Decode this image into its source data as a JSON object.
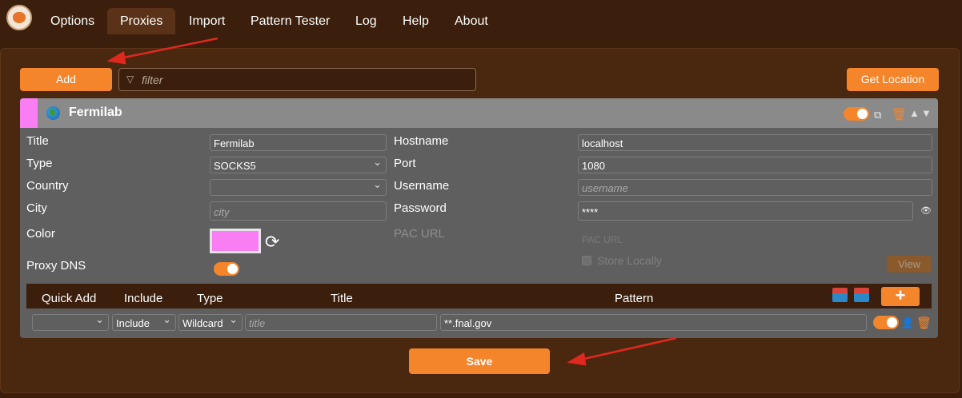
{
  "nav": {
    "tabs": [
      {
        "label": "Options"
      },
      {
        "label": "Proxies"
      },
      {
        "label": "Import"
      },
      {
        "label": "Pattern Tester"
      },
      {
        "label": "Log"
      },
      {
        "label": "Help"
      },
      {
        "label": "About"
      }
    ],
    "active_tab": "Proxies"
  },
  "toolbar": {
    "add_label": "Add",
    "filter_placeholder": "filter",
    "get_location_label": "Get Location"
  },
  "proxy": {
    "title": "Fermilab",
    "color": "#f97ef4",
    "enabled": true,
    "labels": {
      "title": "Title",
      "type": "Type",
      "country": "Country",
      "city": "City",
      "color": "Color",
      "proxy_dns": "Proxy DNS",
      "hostname": "Hostname",
      "port": "Port",
      "username": "Username",
      "password": "Password",
      "pac_url": "PAC URL",
      "store_locally": "Store Locally",
      "view": "View"
    },
    "values": {
      "title": "Fermilab",
      "type": "SOCKS5",
      "country": "",
      "city_placeholder": "city",
      "hostname": "localhost",
      "port": "1080",
      "username_placeholder": "username",
      "password": "****",
      "pac_url_placeholder": "PAC URL"
    },
    "proxy_dns_enabled": true
  },
  "patterns": {
    "headers": [
      "Quick Add",
      "Include",
      "Type",
      "Title",
      "Pattern"
    ],
    "rows": [
      {
        "quick_add": "",
        "include": "Include",
        "type": "Wildcard",
        "title_placeholder": "title",
        "pattern": "**.fnal.gov",
        "enabled": true
      }
    ],
    "add_label": "+"
  },
  "save_label": "Save",
  "colors": {
    "accent": "#f5852a",
    "background": "#3b1f0c",
    "card": "#5f5f5f",
    "annotation_arrow": "#e0281f"
  }
}
